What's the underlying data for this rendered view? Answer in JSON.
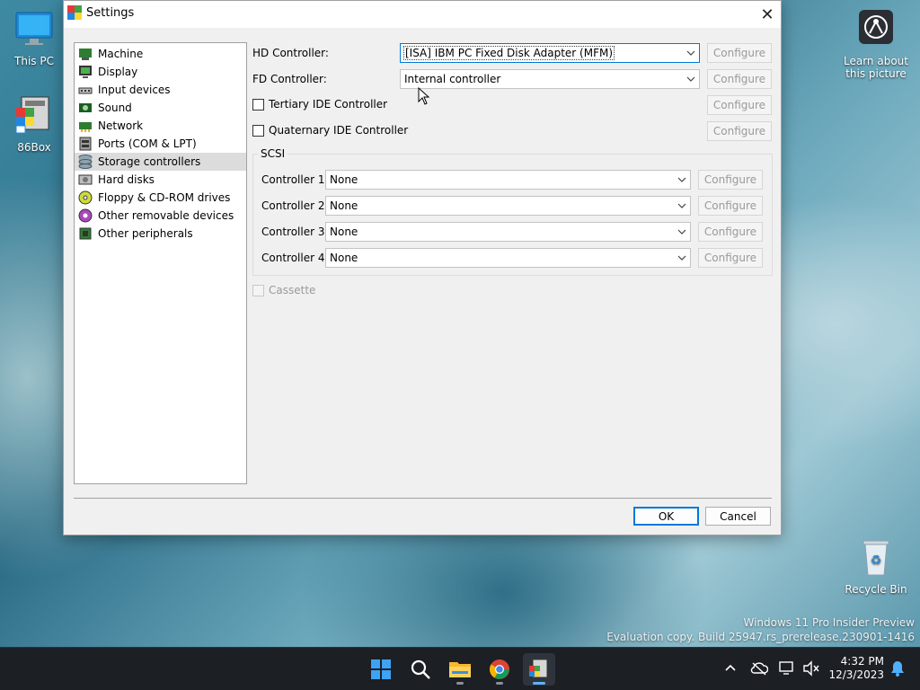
{
  "dialog": {
    "title": "Settings",
    "close_glyph": "✕",
    "nav_items": [
      {
        "label": "Machine",
        "icon": "machine-icon"
      },
      {
        "label": "Display",
        "icon": "display-icon"
      },
      {
        "label": "Input devices",
        "icon": "input-devices-icon"
      },
      {
        "label": "Sound",
        "icon": "sound-icon"
      },
      {
        "label": "Network",
        "icon": "network-icon"
      },
      {
        "label": "Ports (COM & LPT)",
        "icon": "ports-icon"
      },
      {
        "label": "Storage controllers",
        "icon": "storage-controllers-icon"
      },
      {
        "label": "Hard disks",
        "icon": "hard-disks-icon"
      },
      {
        "label": "Floppy & CD-ROM drives",
        "icon": "floppy-cdrom-icon"
      },
      {
        "label": "Other removable devices",
        "icon": "removable-devices-icon"
      },
      {
        "label": "Other peripherals",
        "icon": "peripherals-icon"
      }
    ],
    "selected_nav": "Storage controllers",
    "hd_controller": {
      "label": "HD Controller:",
      "value": "[ISA] IBM PC Fixed Disk Adapter (MFM)",
      "configure": "Configure"
    },
    "fd_controller": {
      "label": "FD Controller:",
      "value": "Internal controller",
      "configure": "Configure"
    },
    "tertiary_ide": {
      "label": "Tertiary IDE Controller",
      "checked": false,
      "configure": "Configure"
    },
    "quaternary_ide": {
      "label": "Quaternary IDE Controller",
      "checked": false,
      "configure": "Configure"
    },
    "scsi": {
      "title": "SCSI",
      "controllers": [
        {
          "label": "Controller 1:",
          "value": "None",
          "configure": "Configure"
        },
        {
          "label": "Controller 2:",
          "value": "None",
          "configure": "Configure"
        },
        {
          "label": "Controller 3:",
          "value": "None",
          "configure": "Configure"
        },
        {
          "label": "Controller 4:",
          "value": "None",
          "configure": "Configure"
        }
      ]
    },
    "cassette": {
      "label": "Cassette",
      "checked": false,
      "enabled": false
    },
    "ok_label": "OK",
    "cancel_label": "Cancel"
  },
  "desktop": {
    "icons": [
      {
        "label": "This PC"
      },
      {
        "label": "86Box"
      },
      {
        "label": "Learn about this picture"
      },
      {
        "label": "Recycle Bin"
      }
    ],
    "watermark_line1": "Windows 11 Pro Insider Preview",
    "watermark_line2": "Evaluation copy. Build 25947.rs_prerelease.230901-1416"
  },
  "taskbar": {
    "apps": [
      "start-icon",
      "search-icon",
      "file-explorer-icon",
      "chrome-icon",
      "86box-icon"
    ],
    "time": "4:32 PM",
    "date": "12/3/2023",
    "accent_color": "#0078d7"
  }
}
